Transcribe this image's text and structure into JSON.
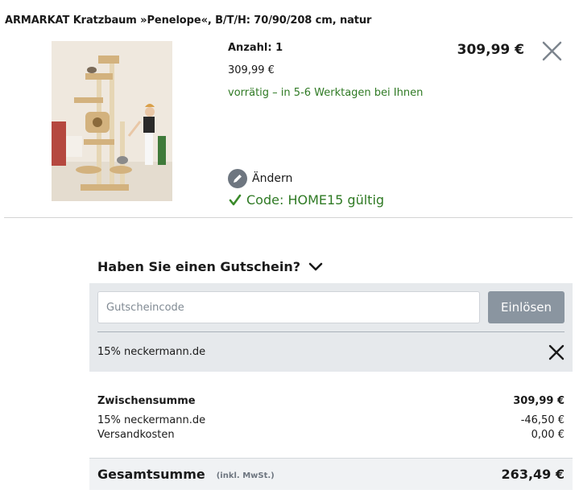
{
  "product": {
    "title": "ARMARKAT Kratzbaum »Penelope«, B/T/H: 70/90/208 cm, natur",
    "image_alt": "Kratzbaum Penelope",
    "quantity": "Anzahl: 1",
    "unit_price": "309,99 €",
    "availability": "vorrätig – in 5-6 Werktagen bei Ihnen",
    "line_total": "309,99 €",
    "edit_label": "Ändern",
    "code_status": "Code: HOME15 gültig"
  },
  "voucher": {
    "toggle_label": "Haben Sie einen Gutschein?",
    "input_placeholder": "Gutscheincode",
    "input_value": "",
    "redeem_label": "Einlösen",
    "applied_label": "15% neckermann.de"
  },
  "summary": {
    "subtotal_label": "Zwischensumme",
    "subtotal_value": "309,99 €",
    "discount_label": "15% neckermann.de",
    "discount_value": "-46,50 €",
    "shipping_label": "Versandkosten",
    "shipping_value": "0,00 €",
    "total_label": "Gesamtsumme",
    "total_note": "(inkl. MwSt.)",
    "total_value": "263,49 €"
  },
  "colors": {
    "success_green": "#2f7a24",
    "panel_gray": "#e6e9ec",
    "button_gray": "#8a95a0"
  }
}
